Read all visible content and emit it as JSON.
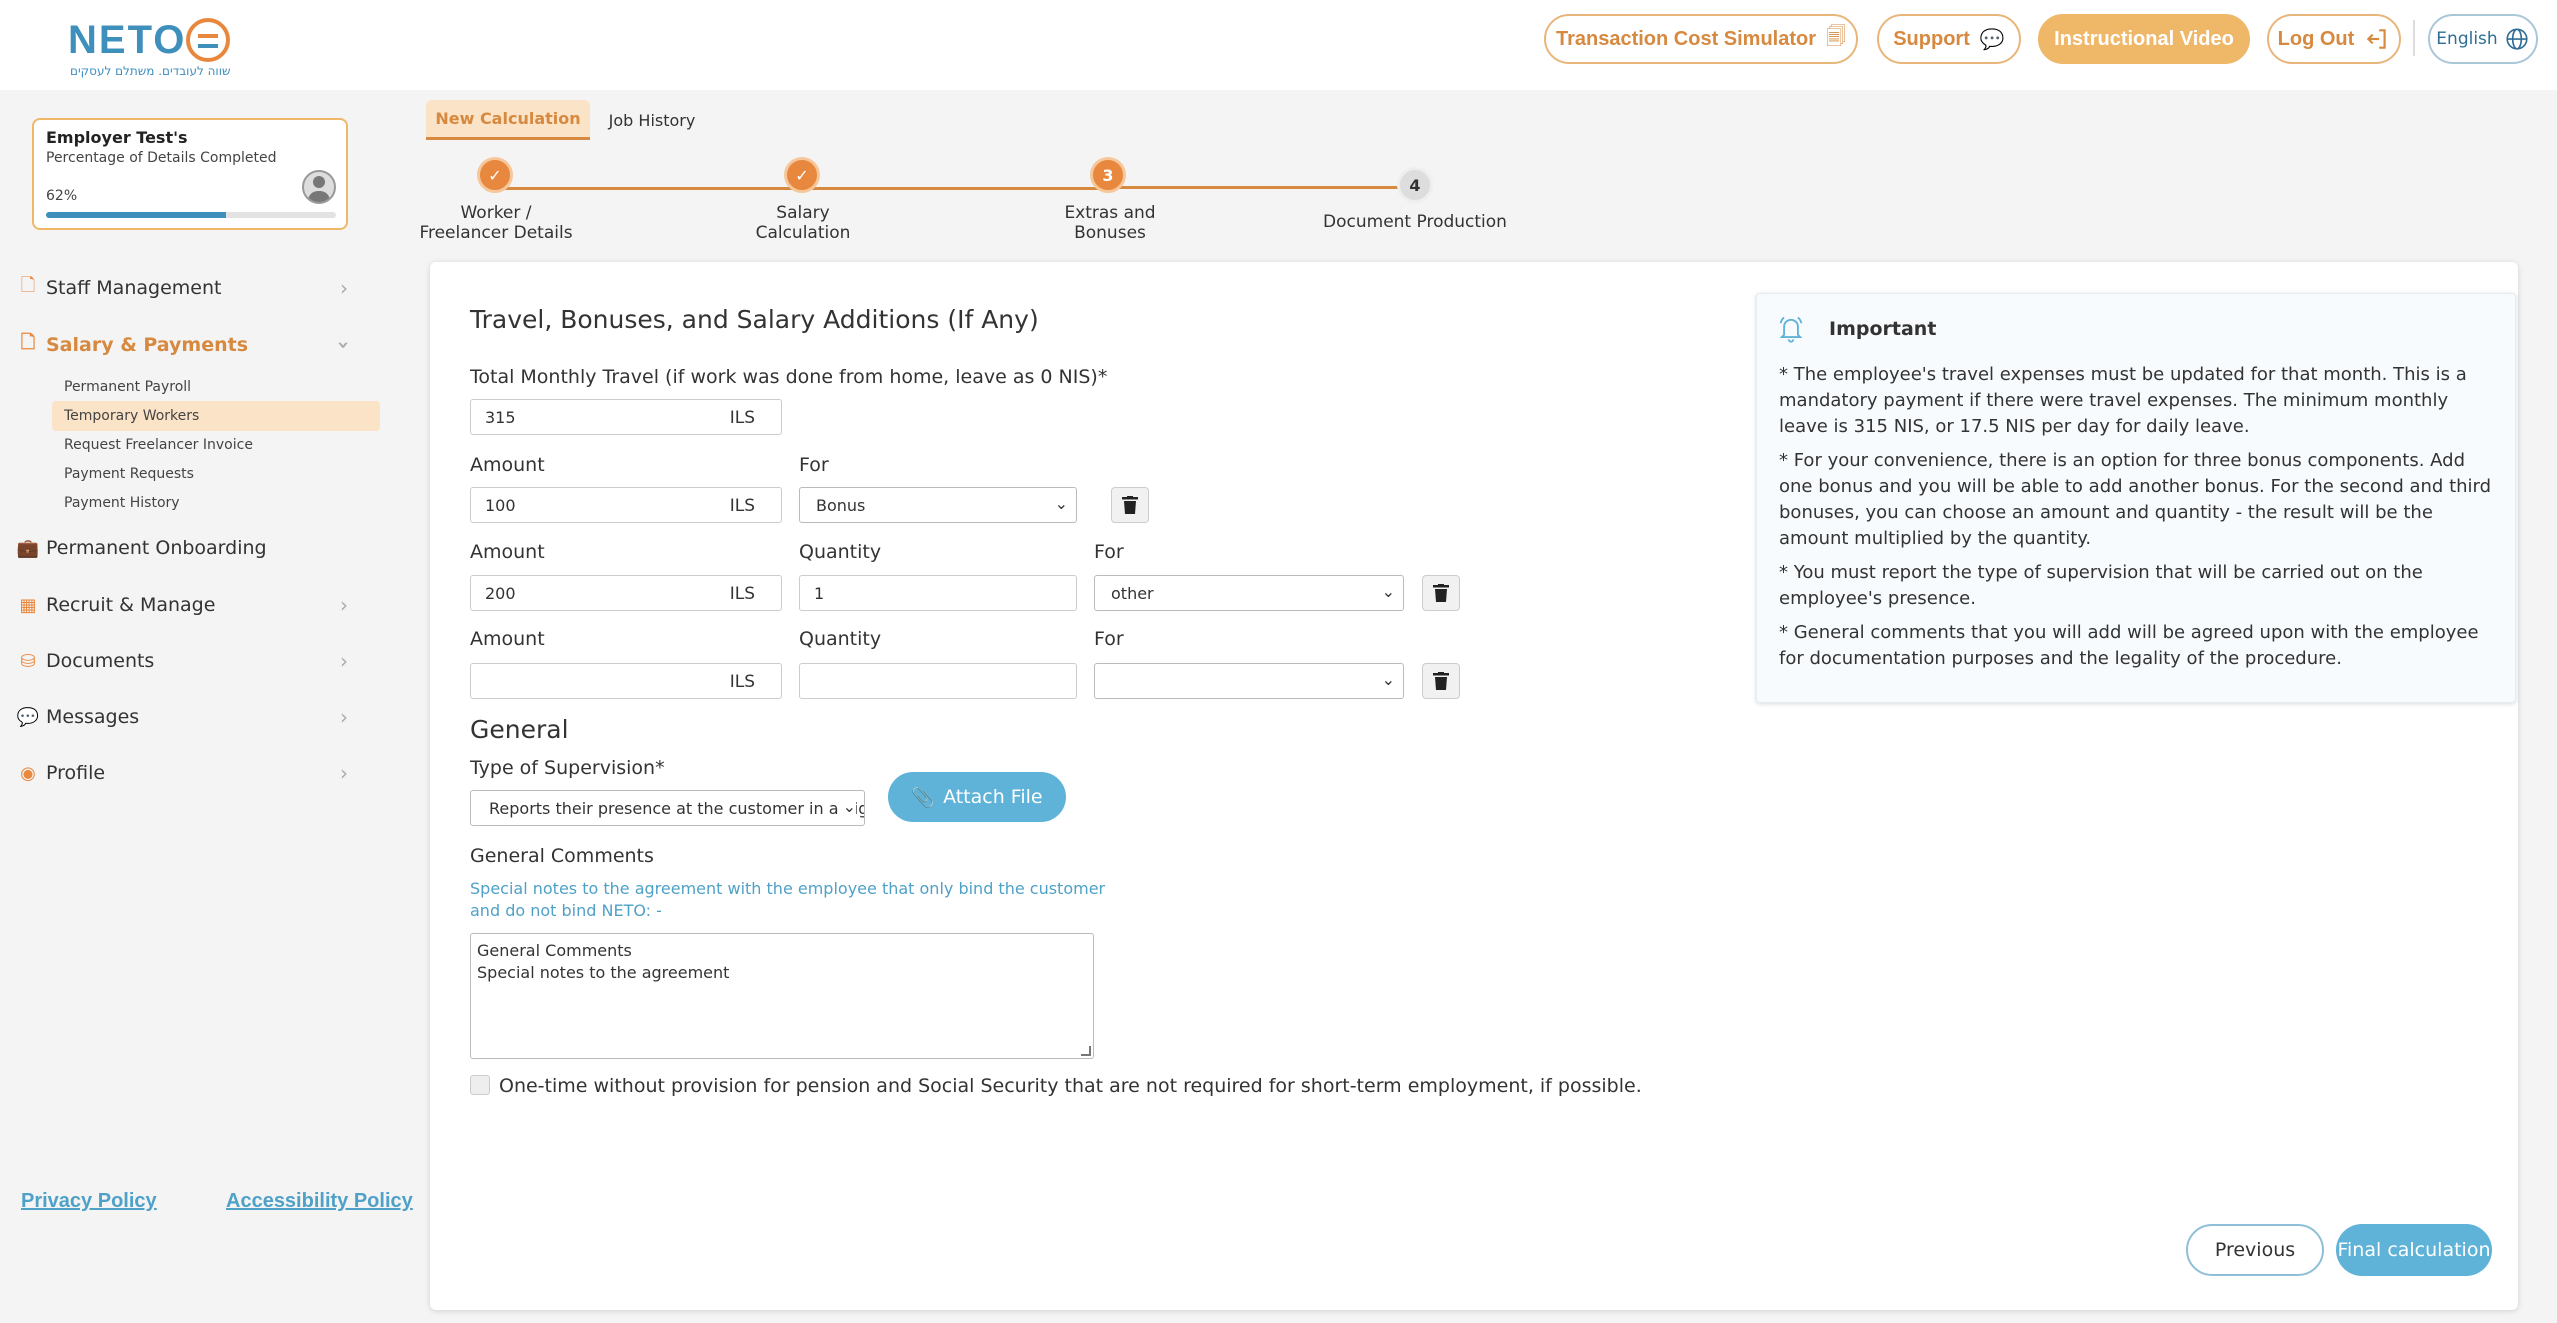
{
  "header": {
    "logo_text": "NETO",
    "logo_tagline": "שווה לעובדים. משתלם לעסקים",
    "buttons": {
      "simulator": "Transaction Cost Simulator",
      "support": "Support",
      "video": "Instructional Video",
      "logout": "Log Out",
      "language": "English"
    }
  },
  "profile": {
    "name": "Employer Test's",
    "subtitle": "Percentage of Details Completed",
    "percent_label": "62%",
    "percent": 62
  },
  "sidebar": {
    "items": [
      {
        "label": "Staff Management"
      },
      {
        "label": "Salary & Payments"
      },
      {
        "label": "Permanent Onboarding"
      },
      {
        "label": "Recruit & Manage"
      },
      {
        "label": "Documents"
      },
      {
        "label": "Messages"
      },
      {
        "label": "Profile"
      }
    ],
    "sub_items": [
      {
        "label": "Permanent Payroll"
      },
      {
        "label": "Temporary Workers"
      },
      {
        "label": "Request Freelancer Invoice"
      },
      {
        "label": "Payment Requests"
      },
      {
        "label": "Payment History"
      }
    ],
    "footer": {
      "privacy": "Privacy Policy",
      "accessibility": "Accessibility Policy"
    }
  },
  "tabs": [
    {
      "label": "New Calculation"
    },
    {
      "label": "Job History"
    }
  ],
  "steps": [
    {
      "label_line1": "Worker /",
      "label_line2": "Freelancer Details",
      "status": "done"
    },
    {
      "label_line1": "Salary",
      "label_line2": "Calculation",
      "status": "done"
    },
    {
      "number": "3",
      "label_line1": "Extras and",
      "label_line2": "Bonuses",
      "status": "current"
    },
    {
      "number": "4",
      "label_line1": "Document Production",
      "label_line2": "",
      "status": "pending"
    }
  ],
  "form": {
    "title": "Travel, Bonuses, and Salary Additions (If Any)",
    "travel_label": "Total Monthly Travel (if work was done from home, leave as 0 NIS)*",
    "travel_value": "315",
    "currency": "ILS",
    "amount_label": "Amount",
    "quantity_label": "Quantity",
    "for_label": "For",
    "rows": [
      {
        "amount": "100",
        "for": "Bonus"
      },
      {
        "amount": "200",
        "quantity": "1",
        "for": "other"
      },
      {
        "amount": "",
        "quantity": "",
        "for": ""
      }
    ],
    "general_title": "General",
    "supervision_label": "Type of Supervision*",
    "supervision_value": "Reports their presence at the customer in a digital",
    "attach_label": "Attach File",
    "comments_label": "General Comments",
    "comments_hint": "Special notes to the agreement with the employee that only bind the customer and do not bind NETO: -",
    "comments_line1": "General Comments",
    "comments_line2": "Special notes to the agreement",
    "checkbox_label": "One-time without provision for pension and Social Security that are not required for short-term employment, if possible.",
    "previous": "Previous",
    "final": "Final calculation"
  },
  "important": {
    "title": "Important",
    "paragraphs": [
      "* The employee's travel expenses must be updated for that month. This is a mandatory payment if there were travel expenses. The minimum monthly leave is 315 NIS, or 17.5 NIS per day for daily leave.",
      "* For your convenience, there is an option for three bonus components. Add one bonus and you will be able to add another bonus. For the second and third bonuses, you can choose an amount and quantity - the result will be the amount multiplied by the quantity.",
      "* You must report the type of supervision that will be carried out on the employee's presence.",
      "* General comments that you will add will be agreed upon with the employee for documentation purposes and the legality of the procedure."
    ]
  },
  "colors": {
    "accent_orange": "#e8873e",
    "accent_blue": "#5fb2d8",
    "brand_blue": "#3f8fbd"
  }
}
